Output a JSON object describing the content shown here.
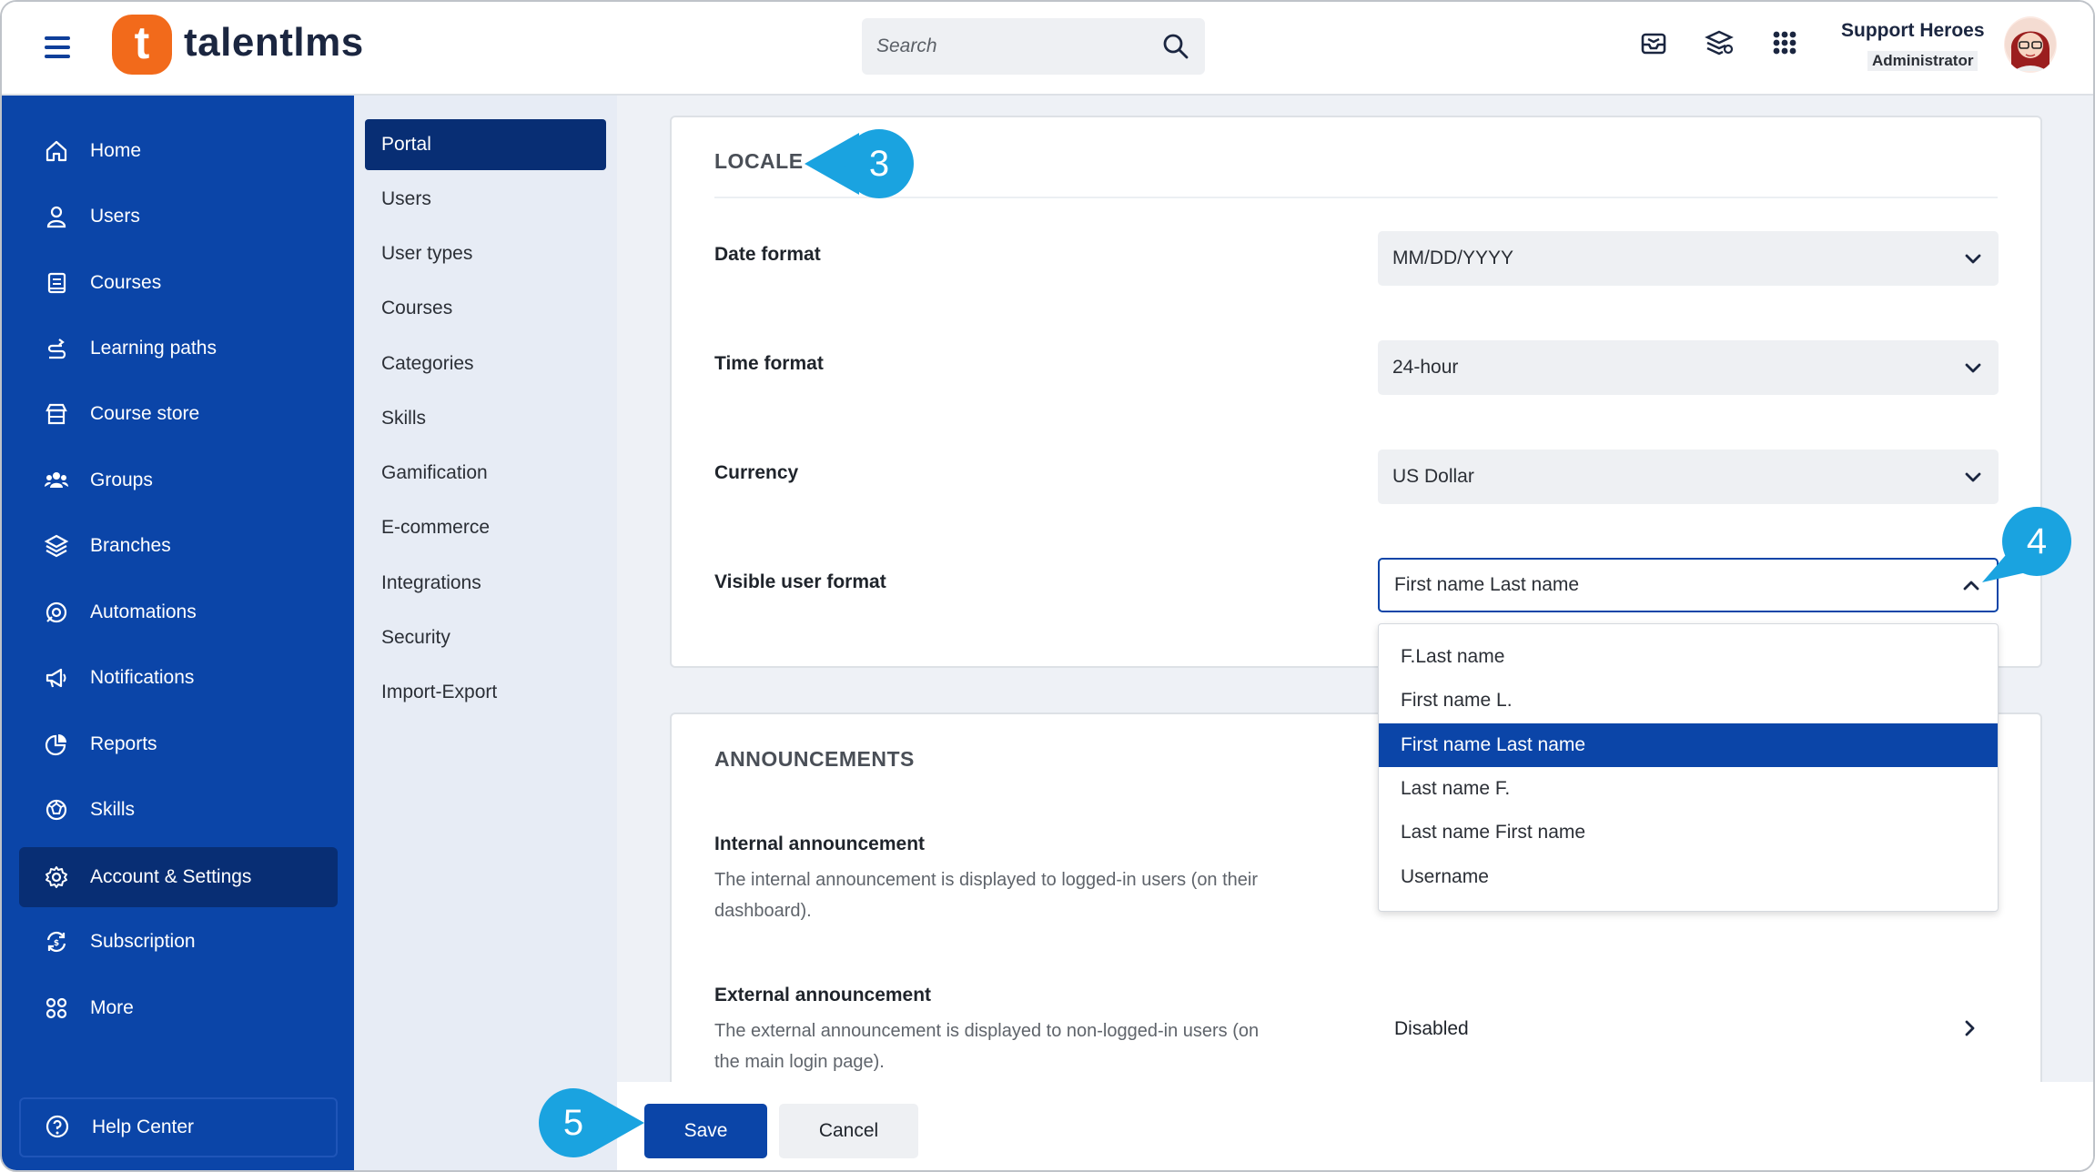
{
  "header": {
    "logo_letter": "t",
    "logo_text": "talentlms",
    "search_placeholder": "Search",
    "user_name": "Support Heroes",
    "user_role": "Administrator",
    "icons": [
      "inbox-icon",
      "layers-icon",
      "apps-grid-icon"
    ]
  },
  "sidebar": {
    "items": [
      {
        "label": "Home",
        "icon": "home-icon"
      },
      {
        "label": "Users",
        "icon": "user-icon"
      },
      {
        "label": "Courses",
        "icon": "book-icon"
      },
      {
        "label": "Learning paths",
        "icon": "path-icon"
      },
      {
        "label": "Course store",
        "icon": "store-icon"
      },
      {
        "label": "Groups",
        "icon": "groups-icon"
      },
      {
        "label": "Branches",
        "icon": "branches-icon"
      },
      {
        "label": "Automations",
        "icon": "automations-icon"
      },
      {
        "label": "Notifications",
        "icon": "megaphone-icon"
      },
      {
        "label": "Reports",
        "icon": "pie-chart-icon"
      },
      {
        "label": "Skills",
        "icon": "skills-icon"
      },
      {
        "label": "Account & Settings",
        "icon": "gear-icon"
      },
      {
        "label": "Subscription",
        "icon": "subscription-icon"
      },
      {
        "label": "More",
        "icon": "more-icon"
      }
    ],
    "active_index": 11,
    "help_center": "Help Center"
  },
  "subnav": {
    "items": [
      "Portal",
      "Users",
      "User types",
      "Courses",
      "Categories",
      "Skills",
      "Gamification",
      "E-commerce",
      "Integrations",
      "Security",
      "Import-Export"
    ],
    "active_index": 0
  },
  "locale": {
    "title": "LOCALE",
    "date_format": {
      "label": "Date format",
      "value": "MM/DD/YYYY"
    },
    "time_format": {
      "label": "Time format",
      "value": "24-hour"
    },
    "currency": {
      "label": "Currency",
      "value": "US Dollar"
    },
    "visible_user_format": {
      "label": "Visible user format",
      "value": "First name Last name",
      "options": [
        "F.Last name",
        "First name L.",
        "First name Last name",
        "Last name F.",
        "Last name First name",
        "Username"
      ],
      "selected_index": 2
    }
  },
  "announcements": {
    "title": "ANNOUNCEMENTS",
    "internal": {
      "label": "Internal announcement",
      "desc_line1": "The internal announcement is displayed to logged-in users (on their",
      "desc_line2": "dashboard)."
    },
    "external": {
      "label": "External announcement",
      "desc_line1": "The external announcement is displayed to non-logged-in users (on",
      "desc_line2": "the main login page).",
      "value": "Disabled"
    }
  },
  "actions": {
    "save": "Save",
    "cancel": "Cancel"
  },
  "callouts": {
    "c3": "3",
    "c4": "4",
    "c5": "5"
  },
  "colors": {
    "primary": "#0b45a8",
    "active_nav": "#082e74",
    "accent": "#f26a1b",
    "callout": "#1aa3e0"
  }
}
